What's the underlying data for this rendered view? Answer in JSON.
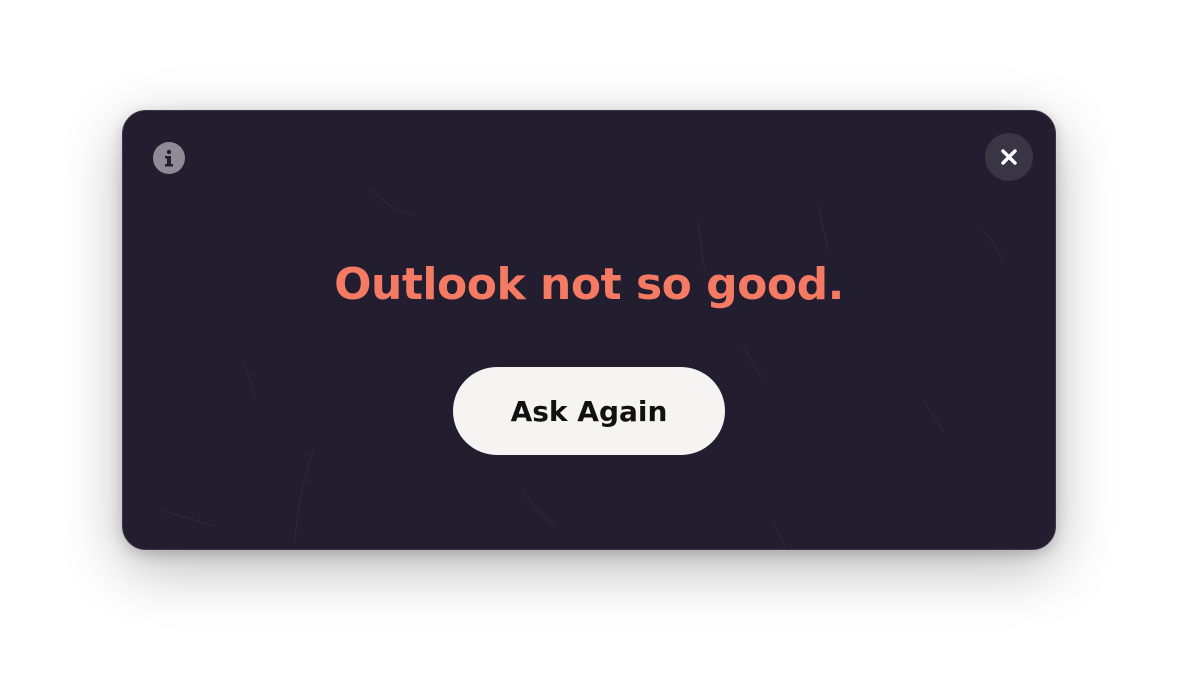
{
  "dialog": {
    "answer_text": "Outlook not so good.",
    "ask_again_label": "Ask Again",
    "info_icon": "info-icon",
    "close_icon": "close-icon"
  },
  "colors": {
    "background": "#221e30",
    "answer_text": "#f57a64",
    "button_background": "#f5f4f2",
    "button_text": "#111111",
    "info_button": "#8e8b97",
    "close_button": "#3a3545"
  }
}
